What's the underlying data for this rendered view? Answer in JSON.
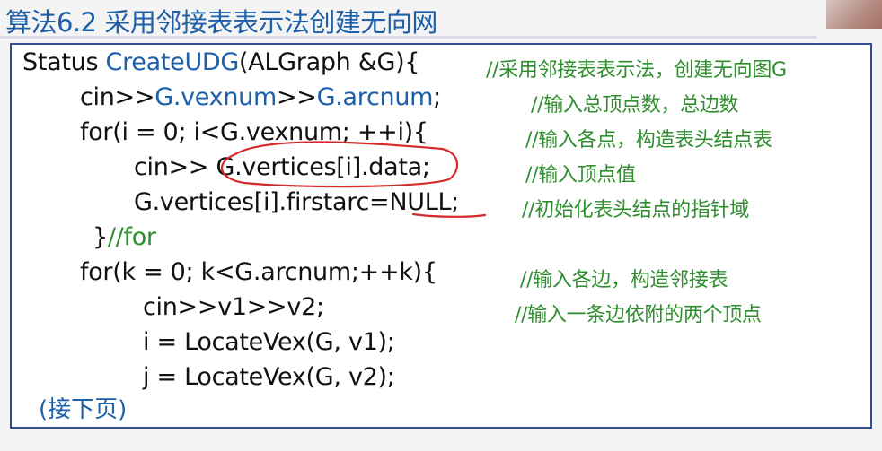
{
  "title": "算法6.2 采用邻接表表示法创建无向网",
  "lines": {
    "l1": {
      "pre": "Status ",
      "fn": "CreateUDG",
      "post": "(ALGraph &G){",
      "comment": "//采用邻接表表示法，创建无向图G"
    },
    "l2": {
      "pre": "cin>>",
      "a": "G.vexnum",
      "mid": ">>",
      "b": "G.arcnum",
      "post": ";",
      "comment": "//输入总顶点数，总边数"
    },
    "l3": {
      "code": "for(i = 0; i<G.vexnum; ++i){",
      "comment": "//输入各点，构造表头结点表"
    },
    "l4": {
      "code": "cin>> G.vertices[i].data;",
      "comment": "//输入顶点值"
    },
    "l5": {
      "code": "G.vertices[i].firstarc=NULL;",
      "comment": "//初始化表头结点的指针域"
    },
    "l6": {
      "code": "}",
      "comment": "//for"
    },
    "l7": {
      "code": "for(k = 0; k<G.arcnum;++k){",
      "comment": "//输入各边，构造邻接表"
    },
    "l8": {
      "code": "cin>>v1>>v2;",
      "comment": "//输入一条边依附的两个顶点"
    },
    "l9": {
      "code": "i = LocateVex(G, v1);"
    },
    "l10": {
      "code": "j = LocateVex(G, v2);"
    }
  },
  "continue_note": "(接下页)",
  "colors": {
    "keyword_blue": "#1d5fa8",
    "comment_green": "#2f8f2f",
    "annotation_red": "#d42a2a",
    "frame_border": "#2f4f8f"
  }
}
